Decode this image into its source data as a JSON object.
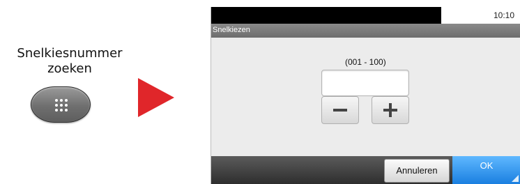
{
  "instruction": {
    "line1": "Snelkiesnummer",
    "line2": "zoeken"
  },
  "hardware_key": {
    "icon": "keypad-icon"
  },
  "arrow": {
    "color": "#e0262a"
  },
  "screen": {
    "status": {
      "time": "10:10"
    },
    "title": "Snelkiezen",
    "range_label": "(001 - 100)",
    "number_input": {
      "value": ""
    },
    "stepper": {
      "minus_icon": "minus-icon",
      "plus_icon": "plus-icon"
    },
    "buttons": {
      "cancel": "Annuleren",
      "ok": "OK",
      "ok_color": "#1a7fe0"
    }
  }
}
